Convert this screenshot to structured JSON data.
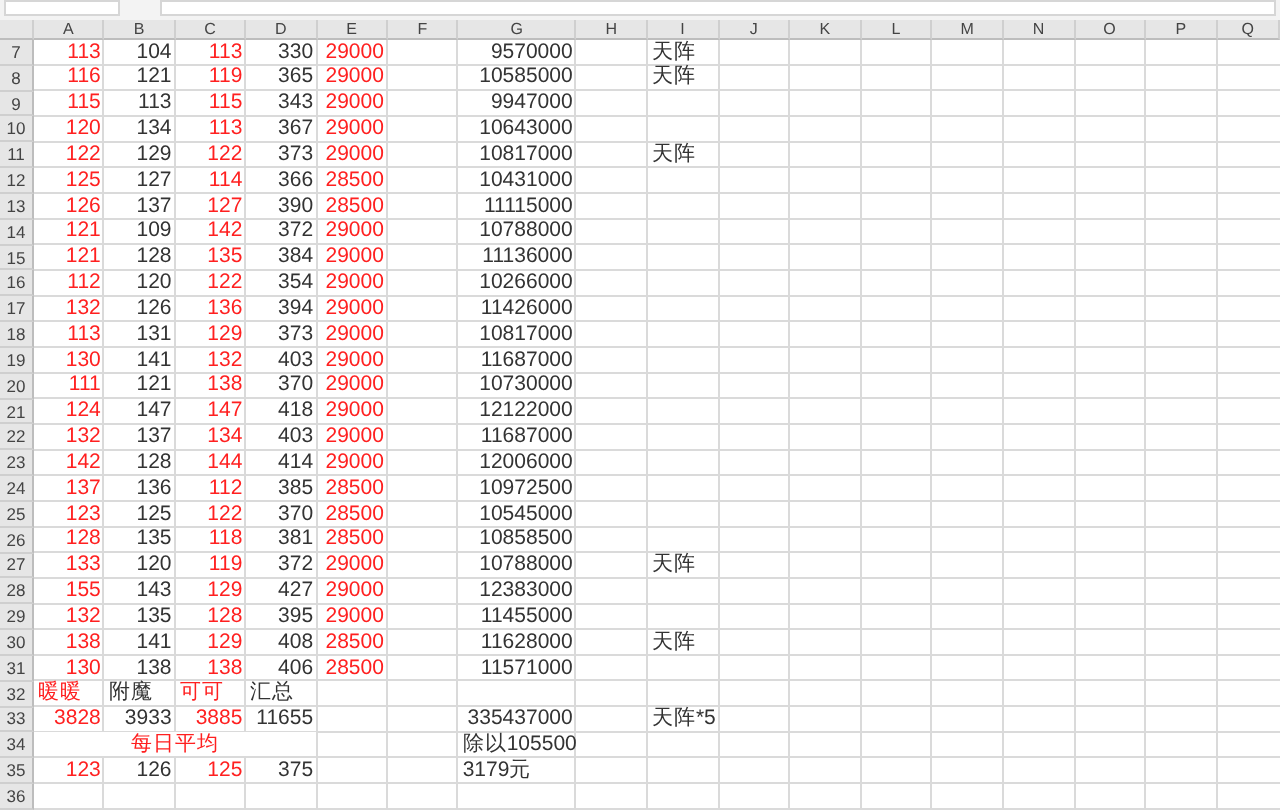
{
  "columns": [
    {
      "label": "A"
    },
    {
      "label": "B"
    },
    {
      "label": "C"
    },
    {
      "label": "D"
    },
    {
      "label": "E"
    },
    {
      "label": "F"
    },
    {
      "label": "G"
    },
    {
      "label": "H"
    },
    {
      "label": "I"
    },
    {
      "label": "J"
    },
    {
      "label": "K"
    },
    {
      "label": "L"
    },
    {
      "label": "M"
    },
    {
      "label": "N"
    },
    {
      "label": "O"
    },
    {
      "label": "P"
    },
    {
      "label": "Q"
    }
  ],
  "rows": [
    {
      "number": "7",
      "cells": [
        {
          "text": "113",
          "kind": "number",
          "color": "#ff2020"
        },
        {
          "text": "104",
          "kind": "number",
          "color": "#333333"
        },
        {
          "text": "113",
          "kind": "number",
          "color": "#ff2020"
        },
        {
          "text": "330",
          "kind": "number",
          "color": "#333333"
        },
        {
          "text": "29000",
          "kind": "number",
          "color": "#ff2020"
        },
        null,
        {
          "text": "9570000",
          "kind": "number",
          "color": "#333333"
        },
        null,
        {
          "text": "天阵",
          "kind": "text",
          "color": "#333333"
        }
      ]
    },
    {
      "number": "8",
      "cells": [
        {
          "text": "116",
          "kind": "number",
          "color": "#ff2020"
        },
        {
          "text": "121",
          "kind": "number",
          "color": "#333333"
        },
        {
          "text": "119",
          "kind": "number",
          "color": "#ff2020"
        },
        {
          "text": "365",
          "kind": "number",
          "color": "#333333"
        },
        {
          "text": "29000",
          "kind": "number",
          "color": "#ff2020"
        },
        null,
        {
          "text": "10585000",
          "kind": "number",
          "color": "#333333"
        },
        null,
        {
          "text": "天阵",
          "kind": "text",
          "color": "#333333"
        }
      ]
    },
    {
      "number": "9",
      "cells": [
        {
          "text": "115",
          "kind": "number",
          "color": "#ff2020"
        },
        {
          "text": "113",
          "kind": "number",
          "color": "#333333"
        },
        {
          "text": "115",
          "kind": "number",
          "color": "#ff2020"
        },
        {
          "text": "343",
          "kind": "number",
          "color": "#333333"
        },
        {
          "text": "29000",
          "kind": "number",
          "color": "#ff2020"
        },
        null,
        {
          "text": "9947000",
          "kind": "number",
          "color": "#333333"
        }
      ]
    },
    {
      "number": "10",
      "cells": [
        {
          "text": "120",
          "kind": "number",
          "color": "#ff2020"
        },
        {
          "text": "134",
          "kind": "number",
          "color": "#333333"
        },
        {
          "text": "113",
          "kind": "number",
          "color": "#ff2020"
        },
        {
          "text": "367",
          "kind": "number",
          "color": "#333333"
        },
        {
          "text": "29000",
          "kind": "number",
          "color": "#ff2020"
        },
        null,
        {
          "text": "10643000",
          "kind": "number",
          "color": "#333333"
        }
      ]
    },
    {
      "number": "11",
      "cells": [
        {
          "text": "122",
          "kind": "number",
          "color": "#ff2020"
        },
        {
          "text": "129",
          "kind": "number",
          "color": "#333333"
        },
        {
          "text": "122",
          "kind": "number",
          "color": "#ff2020"
        },
        {
          "text": "373",
          "kind": "number",
          "color": "#333333"
        },
        {
          "text": "29000",
          "kind": "number",
          "color": "#ff2020"
        },
        null,
        {
          "text": "10817000",
          "kind": "number",
          "color": "#333333"
        },
        null,
        {
          "text": "天阵",
          "kind": "text",
          "color": "#333333"
        }
      ]
    },
    {
      "number": "12",
      "cells": [
        {
          "text": "125",
          "kind": "number",
          "color": "#ff2020"
        },
        {
          "text": "127",
          "kind": "number",
          "color": "#333333"
        },
        {
          "text": "114",
          "kind": "number",
          "color": "#ff2020"
        },
        {
          "text": "366",
          "kind": "number",
          "color": "#333333"
        },
        {
          "text": "28500",
          "kind": "number",
          "color": "#ff2020"
        },
        null,
        {
          "text": "10431000",
          "kind": "number",
          "color": "#333333"
        }
      ]
    },
    {
      "number": "13",
      "cells": [
        {
          "text": "126",
          "kind": "number",
          "color": "#ff2020"
        },
        {
          "text": "137",
          "kind": "number",
          "color": "#333333"
        },
        {
          "text": "127",
          "kind": "number",
          "color": "#ff2020"
        },
        {
          "text": "390",
          "kind": "number",
          "color": "#333333"
        },
        {
          "text": "28500",
          "kind": "number",
          "color": "#ff2020"
        },
        null,
        {
          "text": "11115000",
          "kind": "number",
          "color": "#333333"
        }
      ]
    },
    {
      "number": "14",
      "cells": [
        {
          "text": "121",
          "kind": "number",
          "color": "#ff2020"
        },
        {
          "text": "109",
          "kind": "number",
          "color": "#333333"
        },
        {
          "text": "142",
          "kind": "number",
          "color": "#ff2020"
        },
        {
          "text": "372",
          "kind": "number",
          "color": "#333333"
        },
        {
          "text": "29000",
          "kind": "number",
          "color": "#ff2020"
        },
        null,
        {
          "text": "10788000",
          "kind": "number",
          "color": "#333333"
        }
      ]
    },
    {
      "number": "15",
      "cells": [
        {
          "text": "121",
          "kind": "number",
          "color": "#ff2020"
        },
        {
          "text": "128",
          "kind": "number",
          "color": "#333333"
        },
        {
          "text": "135",
          "kind": "number",
          "color": "#ff2020"
        },
        {
          "text": "384",
          "kind": "number",
          "color": "#333333"
        },
        {
          "text": "29000",
          "kind": "number",
          "color": "#ff2020"
        },
        null,
        {
          "text": "11136000",
          "kind": "number",
          "color": "#333333"
        }
      ]
    },
    {
      "number": "16",
      "cells": [
        {
          "text": "112",
          "kind": "number",
          "color": "#ff2020"
        },
        {
          "text": "120",
          "kind": "number",
          "color": "#333333"
        },
        {
          "text": "122",
          "kind": "number",
          "color": "#ff2020"
        },
        {
          "text": "354",
          "kind": "number",
          "color": "#333333"
        },
        {
          "text": "29000",
          "kind": "number",
          "color": "#ff2020"
        },
        null,
        {
          "text": "10266000",
          "kind": "number",
          "color": "#333333"
        }
      ]
    },
    {
      "number": "17",
      "cells": [
        {
          "text": "132",
          "kind": "number",
          "color": "#ff2020"
        },
        {
          "text": "126",
          "kind": "number",
          "color": "#333333"
        },
        {
          "text": "136",
          "kind": "number",
          "color": "#ff2020"
        },
        {
          "text": "394",
          "kind": "number",
          "color": "#333333"
        },
        {
          "text": "29000",
          "kind": "number",
          "color": "#ff2020"
        },
        null,
        {
          "text": "11426000",
          "kind": "number",
          "color": "#333333"
        }
      ]
    },
    {
      "number": "18",
      "cells": [
        {
          "text": "113",
          "kind": "number",
          "color": "#ff2020"
        },
        {
          "text": "131",
          "kind": "number",
          "color": "#333333"
        },
        {
          "text": "129",
          "kind": "number",
          "color": "#ff2020"
        },
        {
          "text": "373",
          "kind": "number",
          "color": "#333333"
        },
        {
          "text": "29000",
          "kind": "number",
          "color": "#ff2020"
        },
        null,
        {
          "text": "10817000",
          "kind": "number",
          "color": "#333333"
        }
      ]
    },
    {
      "number": "19",
      "cells": [
        {
          "text": "130",
          "kind": "number",
          "color": "#ff2020"
        },
        {
          "text": "141",
          "kind": "number",
          "color": "#333333"
        },
        {
          "text": "132",
          "kind": "number",
          "color": "#ff2020"
        },
        {
          "text": "403",
          "kind": "number",
          "color": "#333333"
        },
        {
          "text": "29000",
          "kind": "number",
          "color": "#ff2020"
        },
        null,
        {
          "text": "11687000",
          "kind": "number",
          "color": "#333333"
        }
      ]
    },
    {
      "number": "20",
      "cells": [
        {
          "text": "111",
          "kind": "number",
          "color": "#ff2020"
        },
        {
          "text": "121",
          "kind": "number",
          "color": "#333333"
        },
        {
          "text": "138",
          "kind": "number",
          "color": "#ff2020"
        },
        {
          "text": "370",
          "kind": "number",
          "color": "#333333"
        },
        {
          "text": "29000",
          "kind": "number",
          "color": "#ff2020"
        },
        null,
        {
          "text": "10730000",
          "kind": "number",
          "color": "#333333"
        }
      ]
    },
    {
      "number": "21",
      "cells": [
        {
          "text": "124",
          "kind": "number",
          "color": "#ff2020"
        },
        {
          "text": "147",
          "kind": "number",
          "color": "#333333"
        },
        {
          "text": "147",
          "kind": "number",
          "color": "#ff2020"
        },
        {
          "text": "418",
          "kind": "number",
          "color": "#333333"
        },
        {
          "text": "29000",
          "kind": "number",
          "color": "#ff2020"
        },
        null,
        {
          "text": "12122000",
          "kind": "number",
          "color": "#333333"
        }
      ]
    },
    {
      "number": "22",
      "cells": [
        {
          "text": "132",
          "kind": "number",
          "color": "#ff2020"
        },
        {
          "text": "137",
          "kind": "number",
          "color": "#333333"
        },
        {
          "text": "134",
          "kind": "number",
          "color": "#ff2020"
        },
        {
          "text": "403",
          "kind": "number",
          "color": "#333333"
        },
        {
          "text": "29000",
          "kind": "number",
          "color": "#ff2020"
        },
        null,
        {
          "text": "11687000",
          "kind": "number",
          "color": "#333333"
        }
      ]
    },
    {
      "number": "23",
      "cells": [
        {
          "text": "142",
          "kind": "number",
          "color": "#ff2020"
        },
        {
          "text": "128",
          "kind": "number",
          "color": "#333333"
        },
        {
          "text": "144",
          "kind": "number",
          "color": "#ff2020"
        },
        {
          "text": "414",
          "kind": "number",
          "color": "#333333"
        },
        {
          "text": "29000",
          "kind": "number",
          "color": "#ff2020"
        },
        null,
        {
          "text": "12006000",
          "kind": "number",
          "color": "#333333"
        }
      ]
    },
    {
      "number": "24",
      "cells": [
        {
          "text": "137",
          "kind": "number",
          "color": "#ff2020"
        },
        {
          "text": "136",
          "kind": "number",
          "color": "#333333"
        },
        {
          "text": "112",
          "kind": "number",
          "color": "#ff2020"
        },
        {
          "text": "385",
          "kind": "number",
          "color": "#333333"
        },
        {
          "text": "28500",
          "kind": "number",
          "color": "#ff2020"
        },
        null,
        {
          "text": "10972500",
          "kind": "number",
          "color": "#333333"
        }
      ]
    },
    {
      "number": "25",
      "cells": [
        {
          "text": "123",
          "kind": "number",
          "color": "#ff2020"
        },
        {
          "text": "125",
          "kind": "number",
          "color": "#333333"
        },
        {
          "text": "122",
          "kind": "number",
          "color": "#ff2020"
        },
        {
          "text": "370",
          "kind": "number",
          "color": "#333333"
        },
        {
          "text": "28500",
          "kind": "number",
          "color": "#ff2020"
        },
        null,
        {
          "text": "10545000",
          "kind": "number",
          "color": "#333333"
        }
      ]
    },
    {
      "number": "26",
      "cells": [
        {
          "text": "128",
          "kind": "number",
          "color": "#ff2020"
        },
        {
          "text": "135",
          "kind": "number",
          "color": "#333333"
        },
        {
          "text": "118",
          "kind": "number",
          "color": "#ff2020"
        },
        {
          "text": "381",
          "kind": "number",
          "color": "#333333"
        },
        {
          "text": "28500",
          "kind": "number",
          "color": "#ff2020"
        },
        null,
        {
          "text": "10858500",
          "kind": "number",
          "color": "#333333"
        }
      ]
    },
    {
      "number": "27",
      "cells": [
        {
          "text": "133",
          "kind": "number",
          "color": "#ff2020"
        },
        {
          "text": "120",
          "kind": "number",
          "color": "#333333"
        },
        {
          "text": "119",
          "kind": "number",
          "color": "#ff2020"
        },
        {
          "text": "372",
          "kind": "number",
          "color": "#333333"
        },
        {
          "text": "29000",
          "kind": "number",
          "color": "#ff2020"
        },
        null,
        {
          "text": "10788000",
          "kind": "number",
          "color": "#333333"
        },
        null,
        {
          "text": "天阵",
          "kind": "text",
          "color": "#333333"
        }
      ]
    },
    {
      "number": "28",
      "cells": [
        {
          "text": "155",
          "kind": "number",
          "color": "#ff2020"
        },
        {
          "text": "143",
          "kind": "number",
          "color": "#333333"
        },
        {
          "text": "129",
          "kind": "number",
          "color": "#ff2020"
        },
        {
          "text": "427",
          "kind": "number",
          "color": "#333333"
        },
        {
          "text": "29000",
          "kind": "number",
          "color": "#ff2020"
        },
        null,
        {
          "text": "12383000",
          "kind": "number",
          "color": "#333333"
        }
      ]
    },
    {
      "number": "29",
      "cells": [
        {
          "text": "132",
          "kind": "number",
          "color": "#ff2020"
        },
        {
          "text": "135",
          "kind": "number",
          "color": "#333333"
        },
        {
          "text": "128",
          "kind": "number",
          "color": "#ff2020"
        },
        {
          "text": "395",
          "kind": "number",
          "color": "#333333"
        },
        {
          "text": "29000",
          "kind": "number",
          "color": "#ff2020"
        },
        null,
        {
          "text": "11455000",
          "kind": "number",
          "color": "#333333"
        }
      ]
    },
    {
      "number": "30",
      "cells": [
        {
          "text": "138",
          "kind": "number",
          "color": "#ff2020"
        },
        {
          "text": "141",
          "kind": "number",
          "color": "#333333"
        },
        {
          "text": "129",
          "kind": "number",
          "color": "#ff2020"
        },
        {
          "text": "408",
          "kind": "number",
          "color": "#333333"
        },
        {
          "text": "28500",
          "kind": "number",
          "color": "#ff2020"
        },
        null,
        {
          "text": "11628000",
          "kind": "number",
          "color": "#333333"
        },
        null,
        {
          "text": "天阵",
          "kind": "text",
          "color": "#333333"
        }
      ]
    },
    {
      "number": "31",
      "cells": [
        {
          "text": "130",
          "kind": "number",
          "color": "#ff2020"
        },
        {
          "text": "138",
          "kind": "number",
          "color": "#333333"
        },
        {
          "text": "138",
          "kind": "number",
          "color": "#ff2020"
        },
        {
          "text": "406",
          "kind": "number",
          "color": "#333333"
        },
        {
          "text": "28500",
          "kind": "number",
          "color": "#ff2020"
        },
        null,
        {
          "text": "11571000",
          "kind": "number",
          "color": "#333333"
        }
      ]
    },
    {
      "number": "32",
      "cells": [
        {
          "text": "暖暖",
          "kind": "text",
          "color": "#ff2020"
        },
        {
          "text": "附魔",
          "kind": "text",
          "color": "#333333"
        },
        {
          "text": "可可",
          "kind": "text",
          "color": "#ff2020"
        },
        {
          "text": "汇总",
          "kind": "text",
          "color": "#333333"
        }
      ]
    },
    {
      "number": "33",
      "cells": [
        {
          "text": "3828",
          "kind": "number",
          "color": "#ff2020"
        },
        {
          "text": "3933",
          "kind": "number",
          "color": "#333333"
        },
        {
          "text": "3885",
          "kind": "number",
          "color": "#ff2020"
        },
        {
          "text": "11655",
          "kind": "number",
          "color": "#333333"
        },
        null,
        null,
        {
          "text": "335437000",
          "kind": "number",
          "color": "#333333"
        },
        null,
        {
          "text": "天阵*5",
          "kind": "text",
          "color": "#333333"
        }
      ]
    },
    {
      "number": "34",
      "cells": [
        {
          "text": "每日平均",
          "kind": "merged",
          "color": "#ff2020"
        },
        null,
        null,
        {
          "text": "除以105500",
          "kind": "text",
          "color": "#333333"
        }
      ]
    },
    {
      "number": "35",
      "cells": [
        {
          "text": "123",
          "kind": "number",
          "color": "#ff2020"
        },
        {
          "text": "126",
          "kind": "number",
          "color": "#333333"
        },
        {
          "text": "125",
          "kind": "number",
          "color": "#ff2020"
        },
        {
          "text": "375",
          "kind": "number",
          "color": "#333333"
        },
        null,
        null,
        {
          "text": "3179元",
          "kind": "text",
          "color": "#333333"
        }
      ]
    },
    {
      "number": "36",
      "cells": []
    }
  ]
}
